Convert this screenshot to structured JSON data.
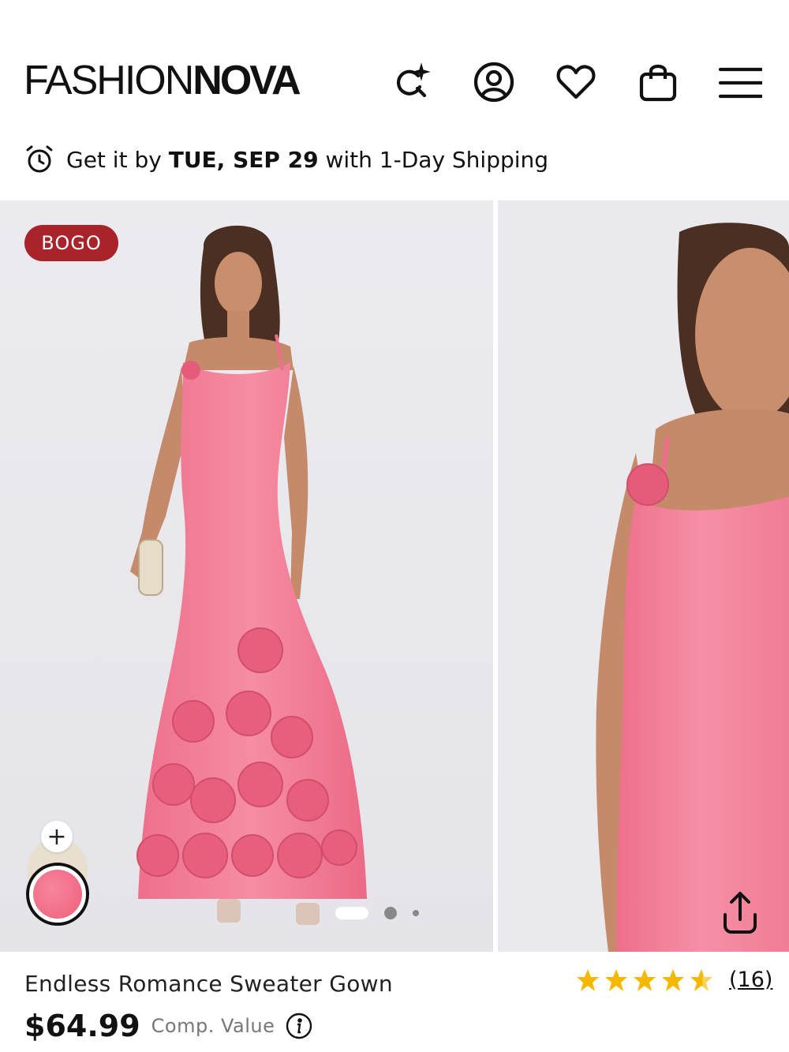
{
  "header": {
    "logo_light": "FASHION",
    "logo_bold": "NOVA",
    "icons": [
      "ai-search-icon",
      "account-icon",
      "wishlist-heart-icon",
      "shopping-bag-icon",
      "hamburger-menu-icon"
    ]
  },
  "shipping_banner": {
    "prefix": "Get it by",
    "date": "TUE, SEP 29",
    "suffix": "with 1-Day Shipping",
    "icon": "alarm-clock-icon"
  },
  "gallery": {
    "badge": "BOGO",
    "add_color_label": "+",
    "slide_count": 3,
    "active_slide": 1,
    "colors": {
      "badge_bg": "#a8232a",
      "dress_pink": "#f07a93",
      "background": "#e8e8ec"
    }
  },
  "product": {
    "name": "Endless Romance Sweater Gown",
    "price": "$64.99",
    "comp_value_label": "Comp. Value",
    "rating_stars": 4.5,
    "review_count": "(16)",
    "star_color": "#f5b800"
  }
}
